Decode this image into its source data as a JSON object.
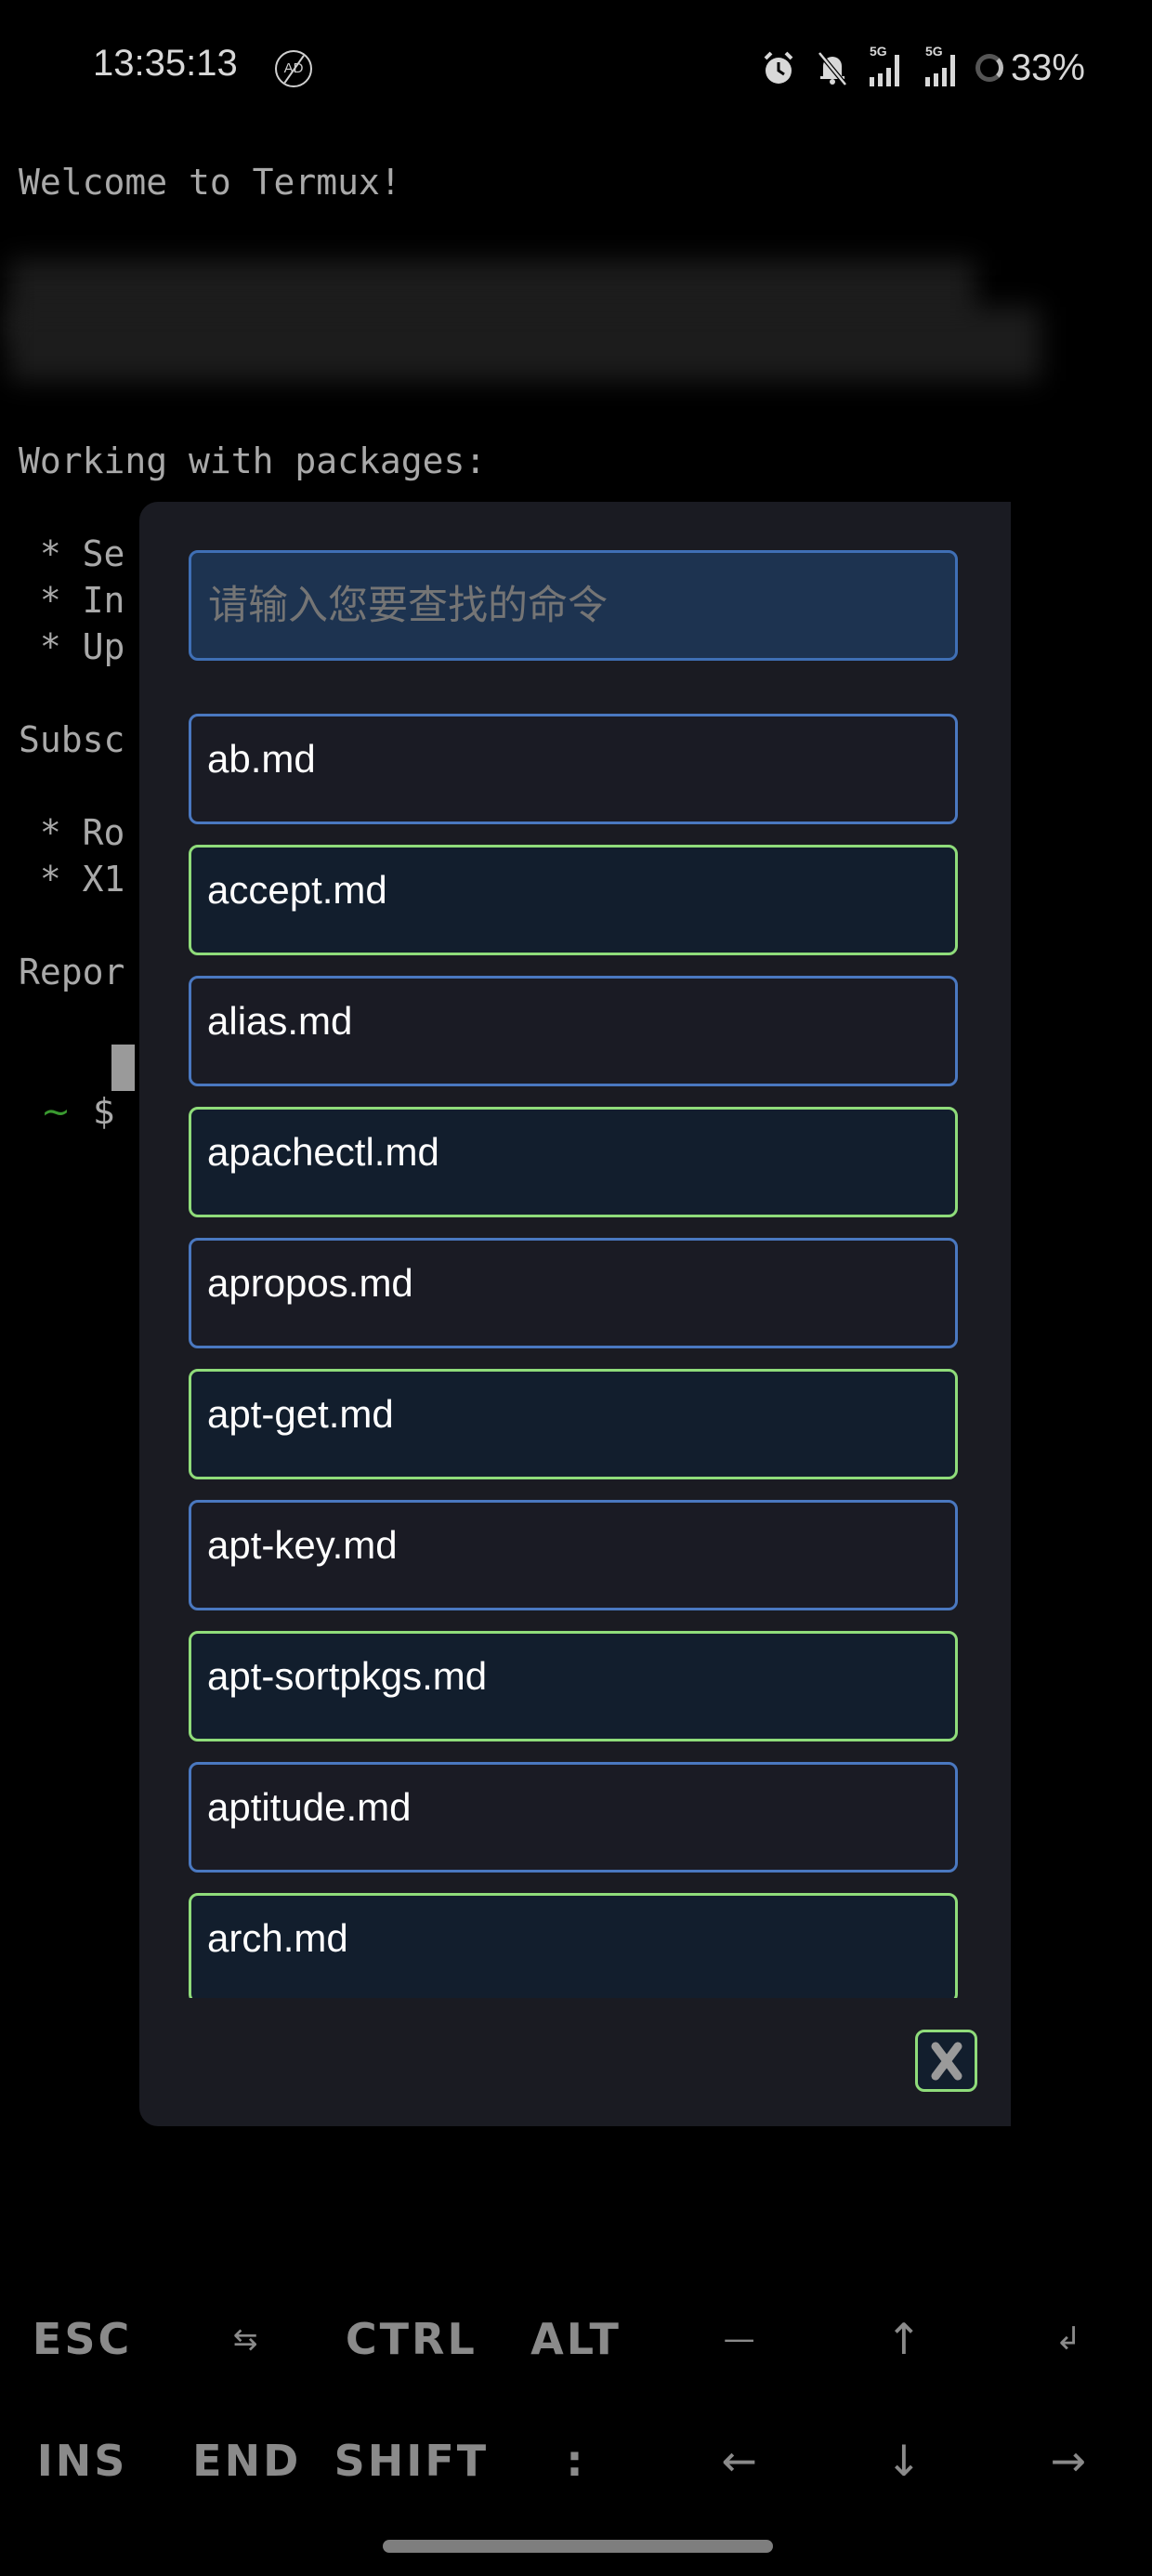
{
  "status_bar": {
    "time": "13:35:13",
    "ad_icon_label": "AD",
    "icons": [
      "alarm-icon",
      "bell-muted-icon",
      "signal-5g-icon",
      "signal-5g-icon",
      "battery-ring-icon"
    ],
    "signal_label": "5G",
    "battery": "33%"
  },
  "terminal": {
    "welcome": "Welcome to Termux!",
    "working_heading": "Working with packages:",
    "bullets_a": [
      " * Se",
      " * In",
      " * Up"
    ],
    "subscribe_heading": "Subsc",
    "bullets_b": [
      " * Ro",
      " * X1"
    ],
    "report_heading": "Repor",
    "prompt_tilde": "~",
    "prompt_symbol": "$"
  },
  "dialog": {
    "search_placeholder": "请输入您要查找的命令",
    "search_value": "",
    "items": [
      {
        "label": "ab.md",
        "style": "blue"
      },
      {
        "label": "accept.md",
        "style": "green"
      },
      {
        "label": "alias.md",
        "style": "blue"
      },
      {
        "label": "apachectl.md",
        "style": "green"
      },
      {
        "label": "apropos.md",
        "style": "blue"
      },
      {
        "label": "apt-get.md",
        "style": "green"
      },
      {
        "label": "apt-key.md",
        "style": "blue"
      },
      {
        "label": "apt-sortpkgs.md",
        "style": "green"
      },
      {
        "label": "aptitude.md",
        "style": "blue"
      },
      {
        "label": "arch.md",
        "style": "green"
      }
    ],
    "close_icon": "close-icon"
  },
  "extra_keys": {
    "row1": [
      "ESC",
      "⇆",
      "CTRL",
      "ALT",
      "—",
      "↑",
      "↲"
    ],
    "row2": [
      "INS",
      "END",
      "SHIFT",
      ":",
      "←",
      "↓",
      "→"
    ]
  },
  "colors": {
    "blue_border": "#4a78c0",
    "green_border": "#8fdc7a",
    "dialog_bg": "#1a1b22"
  }
}
